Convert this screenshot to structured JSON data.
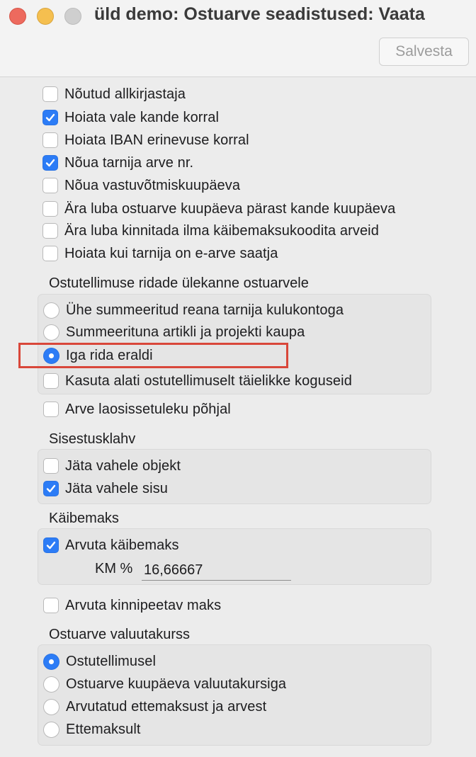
{
  "window": {
    "title": "üld demo: Ostuarve seadistused: Vaata",
    "save_label": "Salvesta"
  },
  "options": {
    "signer_required": "Nõutud allkirjastaja",
    "warn_wrong_entry": "Hoiata vale kande korral",
    "warn_iban_diff": "Hoiata IBAN erinevuse korral",
    "require_invoice_no": "Nõua tarnija arve nr.",
    "require_receipt_date": "Nõua vastuvõtmiskuupäeva",
    "no_date_after_entry": "Ära luba ostuarve kuupäeva pärast kande kuupäeva",
    "no_confirm_without_vat": "Ära luba kinnitada ilma käibemaksukoodita arveid",
    "warn_einvoice_supplier": "Hoiata kui tarnija on e-arve saatja"
  },
  "po_transfer": {
    "heading": "Ostutellimuse ridade ülekanne ostuarvele",
    "radio_summed_supplier": "Ühe summeeritud reana tarnija kulukontoga",
    "radio_summed_item_project": "Summeerituna artikli ja projekti kaupa",
    "radio_each_row": "Iga rida eraldi",
    "always_full_qty": "Kasuta alati ostutellimuselt täielikke koguseid"
  },
  "partial_receipt": "Arve laosissetuleku põhjal",
  "enter_key": {
    "heading": "Sisestusklahv",
    "skip_object": "Jäta vahele objekt",
    "skip_content": "Jäta vahele sisu"
  },
  "vat": {
    "heading": "Käibemaks",
    "calc_vat": "Arvuta käibemaks",
    "km_label": "KM %",
    "km_value": "16,66667"
  },
  "withholding": "Arvuta kinnipeetav maks",
  "currency_rate": {
    "heading": "Ostuarve valuutakurss",
    "from_order": "Ostutellimusel",
    "invoice_date_rate": "Ostuarve kuupäeva valuutakursiga",
    "calc_from_prepayment": "Arvutatud ettemaksust ja arvest",
    "from_prepayment": "Ettemaksult"
  },
  "colors": {
    "accent": "#2c7cf6",
    "highlight": "#d9473a"
  }
}
